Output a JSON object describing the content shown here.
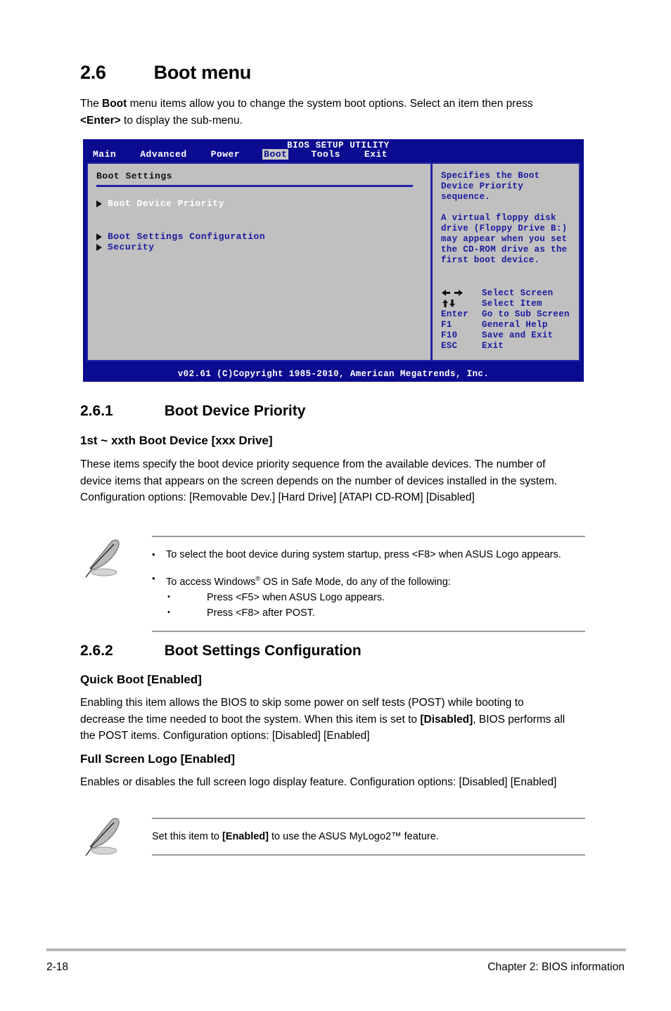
{
  "section": {
    "number": "2.6",
    "title": "Boot menu",
    "intro_1": "The ",
    "intro_bold_1": "Boot",
    "intro_2": " menu items allow you to change the system boot options. Select an item then press ",
    "intro_bold_2": "<Enter>",
    "intro_3": " to display the sub-menu."
  },
  "bios": {
    "utility_title": "BIOS SETUP UTILITY",
    "tabs": [
      {
        "label": "Main",
        "active": false
      },
      {
        "label": "Advanced",
        "active": false
      },
      {
        "label": "Power",
        "active": false
      },
      {
        "label": "Boot",
        "active": true
      },
      {
        "label": "Tools",
        "active": false
      },
      {
        "label": "Exit",
        "active": false
      }
    ],
    "panel_heading": "Boot Settings",
    "items": [
      {
        "label": "Boot Device Priority",
        "selected": true
      },
      {
        "label": "Boot Settings Configuration",
        "selected": false
      },
      {
        "label": "Security",
        "selected": false
      }
    ],
    "help_paragraph_1": "Specifies the Boot\nDevice Priority\nsequence.",
    "help_paragraph_2": "A virtual floppy disk\ndrive (Floppy Drive B:)\nmay appear when you set\nthe CD-ROM drive as the\nfirst boot device.",
    "legend": [
      {
        "key": "left-right-arrows",
        "action": "Select Screen"
      },
      {
        "key": "up-down-arrows",
        "action": "Select Item"
      },
      {
        "key": "Enter",
        "action": "Go to Sub Screen"
      },
      {
        "key": "F1",
        "action": "General Help"
      },
      {
        "key": "F10",
        "action": "Save and Exit"
      },
      {
        "key": "ESC",
        "action": "Exit"
      }
    ],
    "footer": "v02.61 (C)Copyright 1985-2010, American Megatrends, Inc.",
    "colors": {
      "background_blue": "#0b0b8f",
      "panel_gray": "#c0c0c0",
      "accent_blue": "#2222a8",
      "text_blue": "#1a1a9e",
      "tab_highlight": "#c7c7c7"
    }
  },
  "subsection_1": {
    "number": "2.6.1",
    "title": "Boot Device Priority",
    "item_heading": "1st ~ xxth Boot Device [xxx Drive]",
    "body": "These items specify the boot device priority sequence from the available devices. The number of device items that appears on the screen depends on the number of devices installed in the system. Configuration options: [Removable Dev.] [Hard Drive] [ATAPI CD-ROM] [Disabled]"
  },
  "note_1": {
    "icon": "note-pencil-icon",
    "bullet_1": "To select the boot device during system startup, press <F8> when ASUS Logo appears.",
    "bullet_2_pre": "To access Windows",
    "bullet_2_sup": "®",
    "bullet_2_post": " OS in Safe Mode, do any of the following:",
    "sub_bullets": [
      "Press <F5> when ASUS Logo appears.",
      "Press <F8> after POST."
    ]
  },
  "subsection_2": {
    "number": "2.6.2",
    "title": "Boot Settings Configuration",
    "item_heading_1": "Quick Boot [Enabled]",
    "body_1_a": "Enabling this item allows the BIOS to skip some power on self tests (POST) while booting to decrease the time needed to boot the system. When this item is set to ",
    "body_1_bold": "[Disabled]",
    "body_1_b": ", BIOS performs all the POST items. Configuration options: [Disabled] [Enabled]",
    "item_heading_2": "Full Screen Logo [Enabled]",
    "body_2": "Enables or disables the full screen logo display feature. Configuration options: [Disabled] [Enabled]"
  },
  "note_2": {
    "icon": "note-pencil-icon",
    "text_a": "Set this item to ",
    "text_bold": "[Enabled]",
    "text_b": " to use the ASUS MyLogo2™ feature."
  },
  "page_footer": {
    "page_number": "2-18",
    "chapter": "Chapter 2: BIOS information"
  }
}
